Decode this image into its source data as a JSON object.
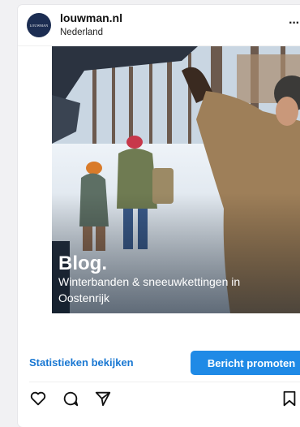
{
  "account": {
    "name": "louwman.nl",
    "location": "Nederland",
    "avatar_text": "LOUWMAN"
  },
  "post": {
    "title": "Blog.",
    "subtitle": "Winterbanden & sneeuwkettingen in Oostenrijk"
  },
  "actions": {
    "stats_label": "Statistieken bekijken",
    "promote_label": "Bericht promoten"
  },
  "icons": {
    "more": "more-icon",
    "like": "heart-icon",
    "comment": "comment-icon",
    "share": "send-icon",
    "save": "bookmark-icon"
  },
  "colors": {
    "accent": "#1877d2",
    "button": "#1f8ae6",
    "avatar_bg": "#1c2d52"
  }
}
